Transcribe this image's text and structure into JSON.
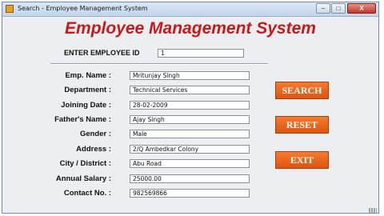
{
  "window": {
    "title": "Search - Employee Management System",
    "controls": {
      "minimize": "–",
      "maximize": "□",
      "close": "X"
    }
  },
  "heading": "Employee Management System",
  "search": {
    "id_label": "ENTER EMPLOYEE ID",
    "id_value": "1"
  },
  "fields": [
    {
      "label": "Emp. Name :",
      "value": "Mritunjay Singh"
    },
    {
      "label": "Department :",
      "value": "Technical Services"
    },
    {
      "label": "Joining Date :",
      "value": "28-02-2009"
    },
    {
      "label": "Father's Name :",
      "value": "Ajay Singh"
    },
    {
      "label": "Gender :",
      "value": "Male"
    },
    {
      "label": "Address :",
      "value": "2/Q Ambedkar Colony"
    },
    {
      "label": "City / District :",
      "value": "Abu Road"
    },
    {
      "label": "Annual Salary :",
      "value": "25000.00"
    },
    {
      "label": "Contact No. :",
      "value": "982569866"
    }
  ],
  "buttons": {
    "search": "SEARCH",
    "reset": "RESET",
    "exit": "EXIT"
  },
  "colors": {
    "heading": "#c61a1a",
    "button": "#f0661e"
  },
  "icons": {
    "app": "java-cup-icon"
  }
}
